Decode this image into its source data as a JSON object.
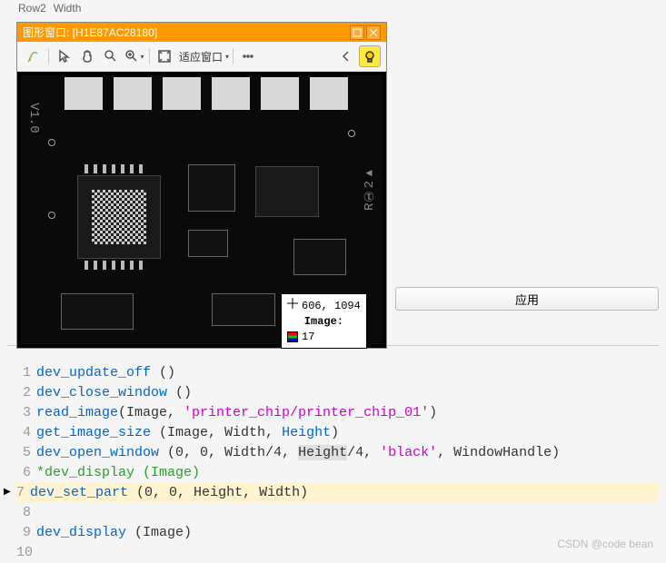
{
  "topbar": {
    "row_label": "Row2",
    "width_label": "Width"
  },
  "window": {
    "title_prefix": "图形窗口:",
    "handle": "[H1E87AC28180]",
    "fit_label": "适应窗口"
  },
  "tooltip": {
    "coords": "606, 1094",
    "image_label": "Image:",
    "value": "17"
  },
  "buttons": {
    "apply": "应用"
  },
  "code": {
    "lines": [
      {
        "n": 1,
        "tokens": [
          [
            "fn",
            "dev_update_off"
          ],
          [
            "id",
            " ()"
          ]
        ]
      },
      {
        "n": 2,
        "tokens": [
          [
            "fn",
            "dev_close_window"
          ],
          [
            "id",
            " ()"
          ]
        ]
      },
      {
        "n": 3,
        "tokens": [
          [
            "fn",
            "read_image"
          ],
          [
            "id",
            "(Image, "
          ],
          [
            "str",
            "'printer_chip/printer_chip_01'"
          ],
          [
            "id",
            ")"
          ]
        ]
      },
      {
        "n": 4,
        "tokens": [
          [
            "fn",
            "get_image_size"
          ],
          [
            "id",
            " (Image, Width, "
          ],
          [
            "op",
            "Height"
          ],
          [
            "id",
            ")"
          ]
        ]
      },
      {
        "n": 5,
        "tokens": [
          [
            "fn",
            "dev_open_window"
          ],
          [
            "id",
            " (0, 0, Width/4, "
          ],
          [
            "kw",
            "Height"
          ],
          [
            "id",
            "/4, "
          ],
          [
            "str",
            "'black'"
          ],
          [
            "id",
            ", WindowHandle)"
          ]
        ]
      },
      {
        "n": 6,
        "tokens": [
          [
            "cm",
            "*dev_display (Image)"
          ]
        ]
      },
      {
        "n": 7,
        "hl": true,
        "bp": true,
        "tokens": [
          [
            "fn",
            "dev_set_part"
          ],
          [
            "id",
            " (0, 0, Height, Width)"
          ]
        ]
      },
      {
        "n": 8,
        "tokens": [
          [
            "id",
            ""
          ]
        ]
      },
      {
        "n": 9,
        "tokens": [
          [
            "fn",
            "dev_display"
          ],
          [
            "id",
            " (Image)"
          ]
        ]
      },
      {
        "n": 10,
        "tokens": [
          [
            "id",
            ""
          ]
        ]
      }
    ]
  },
  "watermark": "CSDN @code bean"
}
